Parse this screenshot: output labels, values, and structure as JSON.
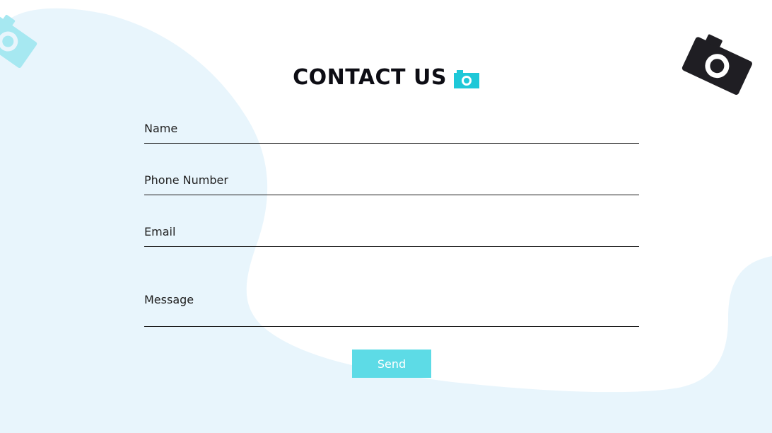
{
  "colors": {
    "background": "#ffffff",
    "blob": "#e8f5fc",
    "accent": "#5ddbe6",
    "title_icon": "#1ec8d8",
    "deco_left_camera": "#a6e8f1",
    "deco_right_camera": "#1f1e23",
    "underline": "#1a1a1a"
  },
  "header": {
    "title": "CONTACT US",
    "title_icon": "camera-icon"
  },
  "form": {
    "fields": [
      {
        "label": "Name",
        "value": ""
      },
      {
        "label": "Phone Number",
        "value": ""
      },
      {
        "label": "Email",
        "value": ""
      },
      {
        "label": "Message",
        "value": ""
      }
    ],
    "submit_label": "Send"
  },
  "decorations": {
    "left_icon": "camera-icon",
    "right_icon": "camera-icon"
  }
}
